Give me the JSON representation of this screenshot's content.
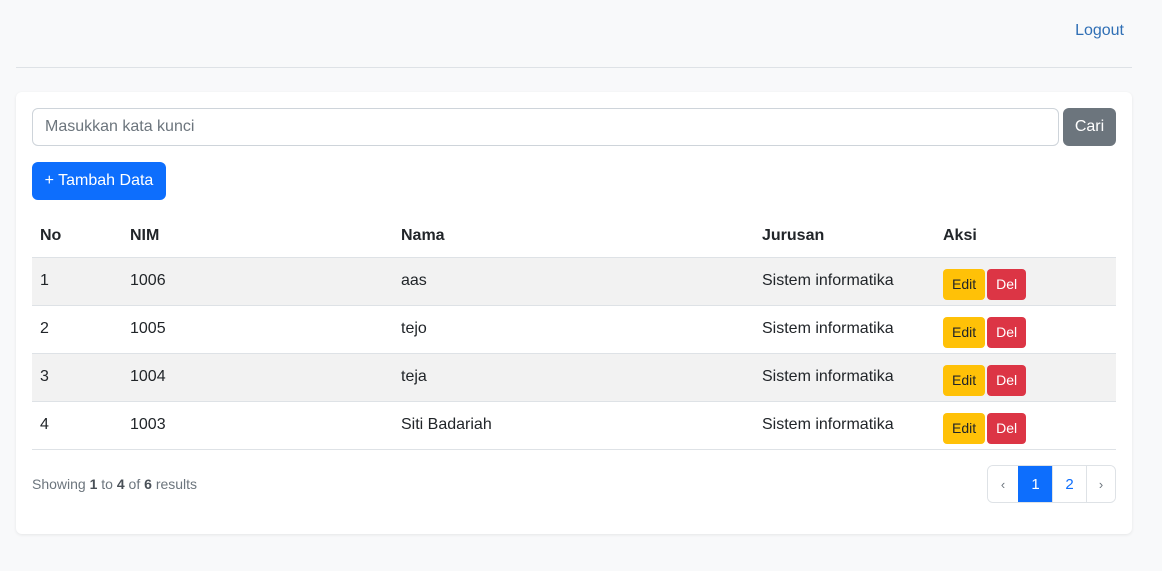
{
  "header": {
    "logout_label": "Logout"
  },
  "search": {
    "placeholder": "Masukkan kata kunci",
    "value": "",
    "button_label": "Cari"
  },
  "add_button_label": "+ Tambah Data",
  "table": {
    "columns": [
      "No",
      "NIM",
      "Nama",
      "Jurusan",
      "Aksi"
    ],
    "rows": [
      {
        "no": "1",
        "nim": "1006",
        "nama": "aas",
        "jurusan": "Sistem informatika"
      },
      {
        "no": "2",
        "nim": "1005",
        "nama": "tejo",
        "jurusan": "Sistem informatika"
      },
      {
        "no": "3",
        "nim": "1004",
        "nama": "teja",
        "jurusan": "Sistem informatika"
      },
      {
        "no": "4",
        "nim": "1003",
        "nama": "Siti Badariah",
        "jurusan": "Sistem informatika"
      }
    ],
    "edit_label": "Edit",
    "delete_label": "Del"
  },
  "footer": {
    "showing_text": "Showing",
    "from": "1",
    "to_text": "to",
    "to": "4",
    "of_text": "of",
    "total": "6",
    "results_text": "results"
  },
  "pagination": {
    "prev": "‹",
    "pages": [
      "1",
      "2"
    ],
    "active_page": "1",
    "next": "›"
  },
  "colors": {
    "primary": "#0d6efd",
    "secondary": "#6c757d",
    "warning": "#ffc107",
    "danger": "#dc3545"
  }
}
